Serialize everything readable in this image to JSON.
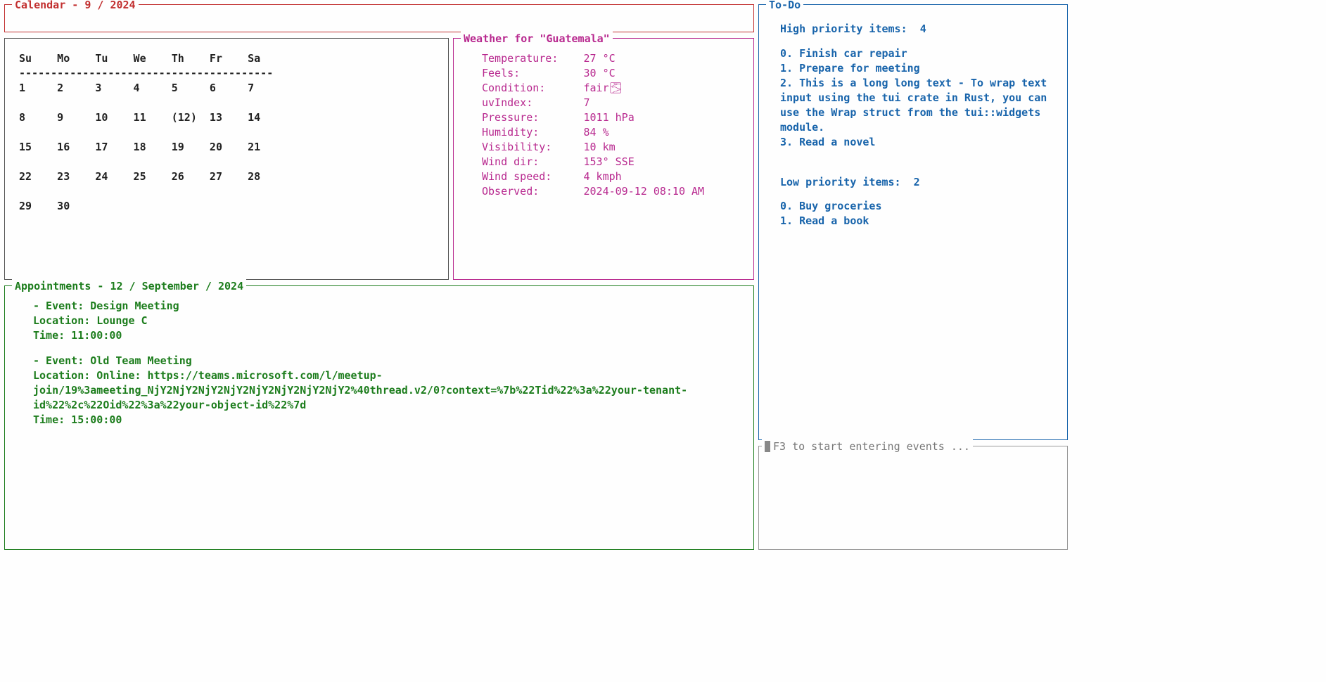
{
  "calendar_title": "Calendar - 9 / 2024",
  "calendar": {
    "weekdays": [
      "Su",
      "Mo",
      "Tu",
      "We",
      "Th",
      "Fr",
      "Sa"
    ],
    "separator": "----------------------------------------",
    "weeks": [
      [
        "1",
        "2",
        "3",
        "4",
        "5",
        "6",
        "7"
      ],
      [
        "8",
        "9",
        "10",
        "11",
        "(12)",
        "13",
        "14"
      ],
      [
        "15",
        "16",
        "17",
        "18",
        "19",
        "20",
        "21"
      ],
      [
        "22",
        "23",
        "24",
        "25",
        "26",
        "27",
        "28"
      ],
      [
        "29",
        "30",
        "",
        "",
        "",
        "",
        ""
      ]
    ],
    "today": "12"
  },
  "weather": {
    "title": "Weather for \"Guatemala\"",
    "rows": [
      {
        "label": "Temperature:",
        "value": "27 °C"
      },
      {
        "label": "Feels:",
        "value": "30 °C"
      },
      {
        "label": "Condition:",
        "value": "fair🌫"
      },
      {
        "label": "uvIndex:",
        "value": "7"
      },
      {
        "label": "Pressure:",
        "value": "1011 hPa"
      },
      {
        "label": "Humidity:",
        "value": "84 %"
      },
      {
        "label": "Visibility:",
        "value": "10 km"
      },
      {
        "label": "Wind dir:",
        "value": "153° SSE"
      },
      {
        "label": "Wind speed:",
        "value": "4 kmph"
      },
      {
        "label": "Observed:",
        "value": "2024-09-12 08:10 AM"
      }
    ]
  },
  "appointments": {
    "title": "Appointments - 12 / September / 2024",
    "events": [
      {
        "name": "Design Meeting",
        "location": "Lounge C",
        "time": "11:00:00"
      },
      {
        "name": "Old Team Meeting",
        "location": "Online: https://teams.microsoft.com/l/meetup-join/19%3ameeting_NjY2NjY2NjY2NjY2NjY2NjY2NjY2NjY2%40thread.v2/0?context=%7b%22Tid%22%3a%22your-tenant-id%22%2c%22Oid%22%3a%22your-object-id%22%7d",
        "time": "15:00:00"
      }
    ],
    "labels": {
      "event": "- Event:",
      "location": "Location:",
      "time": "Time:"
    }
  },
  "todo": {
    "title": "To-Do",
    "high_label": "High priority items:",
    "high_count": "4",
    "high": [
      "Finish car repair",
      "Prepare for meeting",
      "This is a long long text - To wrap text input using the tui crate in Rust, you can use the Wrap struct from the tui::widgets module.",
      "Read a novel"
    ],
    "low_label": "Low priority items:",
    "low_count": "2",
    "low": [
      "Buy groceries",
      "Read a book"
    ]
  },
  "input": {
    "hint": "F3 to start entering events ..."
  }
}
